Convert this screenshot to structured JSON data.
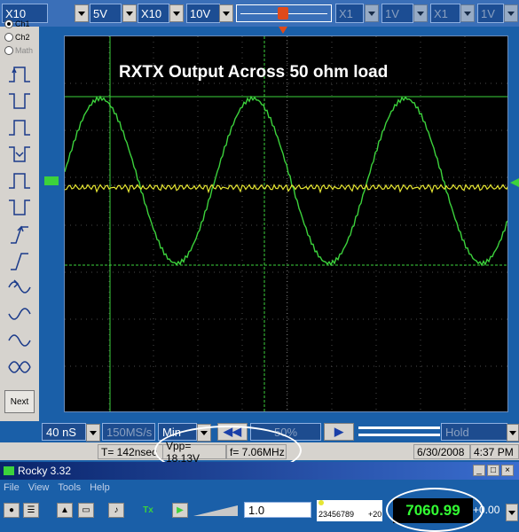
{
  "top_toolbar": {
    "ch1_probe": "X10",
    "ch1_volts": "5V",
    "ch2_probe": "X10",
    "ch2_volts": "10V",
    "ch3_probe": "X1",
    "ch3_volts": "1V",
    "ch4_probe": "X1",
    "ch4_volts": "1V"
  },
  "left_panel": {
    "radio_ch1": "Ch1",
    "radio_ch2": "Ch2",
    "radio_math": "Math",
    "next_label": "Next"
  },
  "scope": {
    "title": "RXTX Output Across 50 ohm load"
  },
  "controls": {
    "timebase": "40 nS",
    "sample_rate": "150MS/s",
    "mode": "Min",
    "percent": "50%",
    "hold": "Hold"
  },
  "status": {
    "t_value": "T= 142nsec",
    "vpp": "Vpp= 18.13V",
    "freq": "f= 7.06MHz",
    "date": "6/30/2008",
    "time": "4:37 PM"
  },
  "rocky": {
    "title": "Rocky 3.32",
    "menu": [
      "File",
      "View",
      "Tools",
      "Help"
    ],
    "gain_value": "1.0",
    "digits": "23456789",
    "step": "+20",
    "frequency": "7060.99",
    "offset": "+0.00"
  },
  "colors": {
    "trace_ch1": "#3cd23c",
    "trace_ch2": "#e6e632",
    "background": "#000000"
  }
}
